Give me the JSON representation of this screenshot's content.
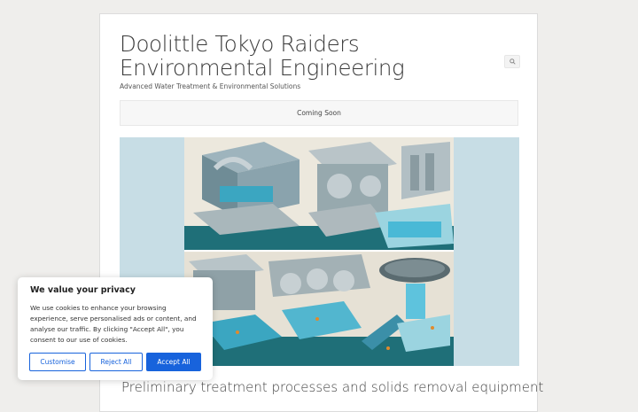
{
  "site": {
    "title": "Doolittle Tokyo Raiders Environmental Engineering",
    "tagline": "Advanced Water Treatment & Environmental Solutions"
  },
  "header": {
    "search_icon": "search-icon"
  },
  "nav": {
    "items": [
      {
        "label": "Coming Soon"
      }
    ]
  },
  "post": {
    "title": "Preliminary treatment processes and solids removal equipment",
    "image_icon": "water-treatment-illustration"
  },
  "cookie_banner": {
    "title": "We value your privacy",
    "text": "We use cookies to enhance your browsing experience, serve personalised ads or content, and analyse our traffic. By clicking \"Accept All\", you consent to our use of cookies.",
    "buttons": {
      "customise": "Customise",
      "reject": "Reject All",
      "accept": "Accept All"
    },
    "accent_color": "#1863dc"
  }
}
